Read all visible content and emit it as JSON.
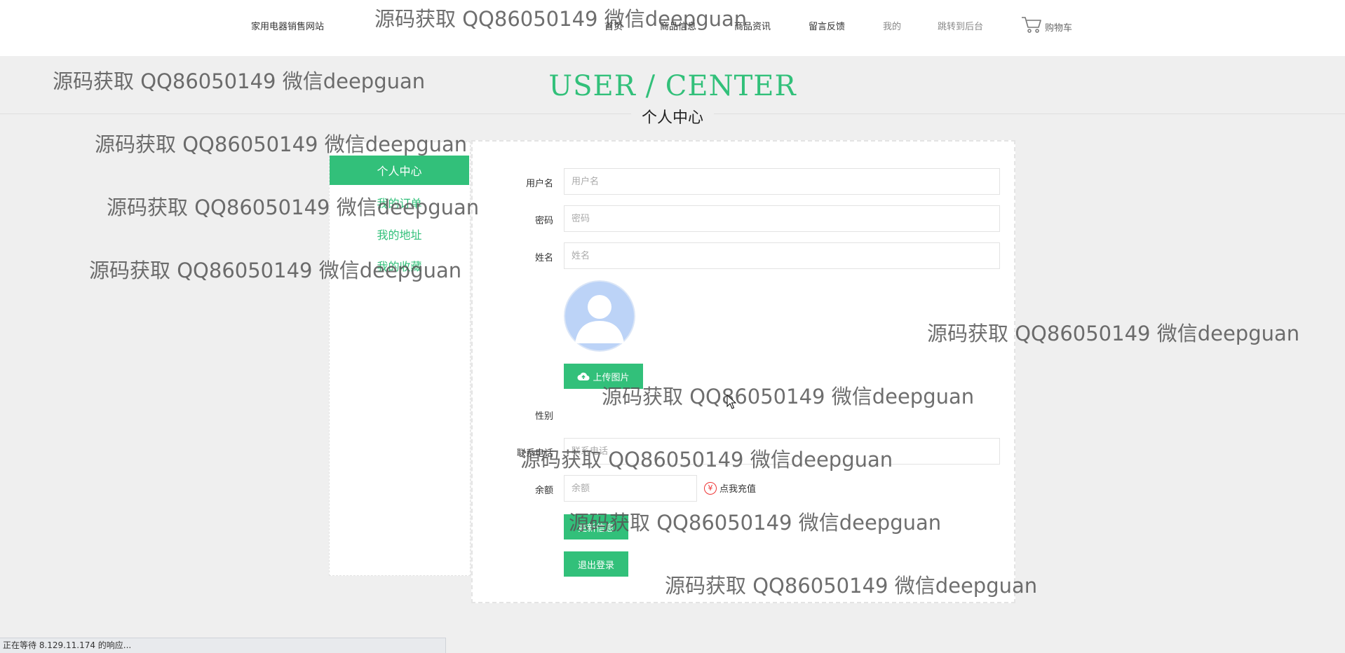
{
  "nav": {
    "brand": "家用电器销售网站",
    "items": [
      {
        "label": "首页"
      },
      {
        "label": "商品信息"
      },
      {
        "label": "商品资讯"
      },
      {
        "label": "留言反馈"
      },
      {
        "label": "我的"
      },
      {
        "label": "跳转到后台"
      }
    ],
    "cart": {
      "label": "购物车",
      "icon": "cart-icon"
    }
  },
  "page": {
    "title_en": "USER / CENTER",
    "title_cn": "个人中心"
  },
  "sidebar": {
    "active": "个人中心",
    "links": [
      {
        "label": "我的订单"
      },
      {
        "label": "我的地址"
      },
      {
        "label": "我的收藏"
      }
    ]
  },
  "form": {
    "username": {
      "label": "用户名",
      "placeholder": "用户名",
      "value": ""
    },
    "password": {
      "label": "密码",
      "placeholder": "密码",
      "value": ""
    },
    "name": {
      "label": "姓名",
      "placeholder": "姓名",
      "value": ""
    },
    "avatar_icon": "avatar-placeholder-icon",
    "upload": {
      "label": "上传图片",
      "icon": "cloud-upload-icon"
    },
    "gender": {
      "label": "性别"
    },
    "phone": {
      "label": "联系电话",
      "placeholder": "联系电话",
      "value": ""
    },
    "balance": {
      "label": "余额",
      "placeholder": "余额",
      "value": ""
    },
    "recharge": {
      "label": "点我充值",
      "icon": "yen-icon",
      "symbol": "¥"
    },
    "update_button": "更新信息",
    "logout_button": "退出登录"
  },
  "watermark": "源码获取 QQ86050149 微信deepguan",
  "status_bar": "正在等待 8.129.11.174 的响应...",
  "colors": {
    "accent": "#32c07a",
    "background": "#efefef",
    "panel": "#ffffff",
    "recharge_icon": "#e33333"
  }
}
